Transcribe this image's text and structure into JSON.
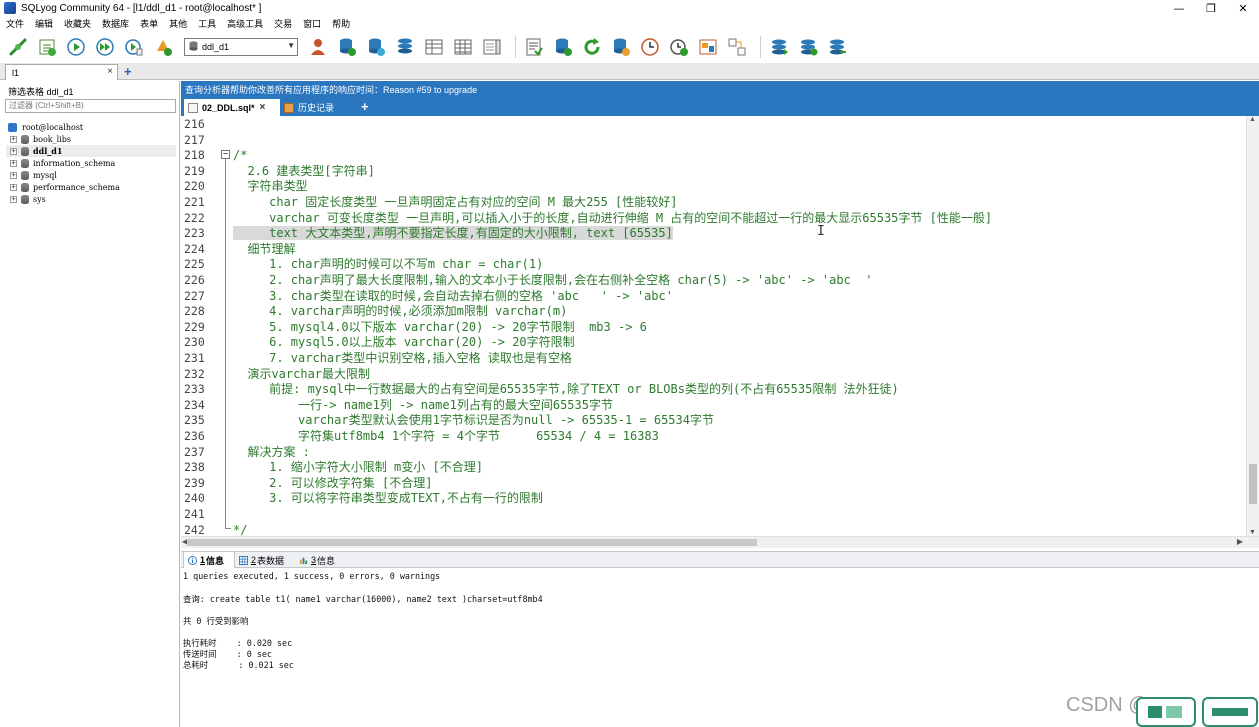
{
  "window": {
    "title": "SQLyog Community 64 - [l1/ddl_d1 - root@localhost* ]",
    "controls": [
      "—",
      "❐",
      "✕"
    ]
  },
  "menu": [
    "文件",
    "编辑",
    "收藏夹",
    "数据库",
    "表单",
    "其他",
    "工具",
    "高级工具",
    "交易",
    "窗口",
    "帮助"
  ],
  "toolbar": {
    "db_selector_value": "ddl_d1"
  },
  "session": {
    "tab_label": "l1",
    "close": "×",
    "add": "+"
  },
  "left_panel": {
    "filter_label": "筛选表格 ddl_d1",
    "filter_placeholder": "过滤器 (Ctrl+Shift+B)",
    "root": "root@localhost",
    "databases": [
      {
        "name": "book_libs",
        "selected": false
      },
      {
        "name": "ddl_d1",
        "selected": true
      },
      {
        "name": "information_schema",
        "selected": false
      },
      {
        "name": "mysql",
        "selected": false
      },
      {
        "name": "performance_schema",
        "selected": false
      },
      {
        "name": "sys",
        "selected": false
      }
    ]
  },
  "notice": "查询分析器帮助你改善所有应用程序的响应时间：Reason #59 to upgrade",
  "editor_tabs": {
    "active": "02_DDL.sql*",
    "active_close": "×",
    "history": "历史记录",
    "add": "+"
  },
  "editor": {
    "line_numbers": [
      "216",
      "217",
      "218",
      "219",
      "220",
      "221",
      "222",
      "223",
      "224",
      "225",
      "226",
      "227",
      "228",
      "229",
      "230",
      "231",
      "232",
      "233",
      "234",
      "235",
      "236",
      "237",
      "238",
      "239",
      "240",
      "241",
      "242"
    ],
    "fold_marker": "−",
    "lines": [
      "",
      "",
      "/*",
      "  2.6 建表类型[字符串]",
      "  字符串类型",
      "     char 固定长度类型 一旦声明固定占有对应的空间 M 最大255 [性能较好]",
      "     varchar 可变长度类型 一旦声明,可以插入小于的长度,自动进行伸缩 M 占有的空间不能超过一行的最大显示65535字节 [性能一般]",
      "     text 大文本类型,声明不要指定长度,有固定的大小限制, text [65535]",
      "  细节理解",
      "     1. char声明的时候可以不写m char = char(1)",
      "     2. char声明了最大长度限制,输入的文本小于长度限制,会在右侧补全空格 char(5) -> 'abc' -> 'abc  '",
      "     3. char类型在读取的时候,会自动去掉右侧的空格 'abc   ' -> 'abc'",
      "     4. varchar声明的时候,必须添加m限制 varchar(m)",
      "     5. mysql4.0以下版本 varchar(20) -> 20字节限制  mb3 -> 6",
      "     6. mysql5.0以上版本 varchar(20) -> 20字符限制",
      "     7. varchar类型中识别空格,插入空格 读取也是有空格",
      "  演示varchar最大限制",
      "     前提: mysql中一行数据最大的占有空间是65535字节,除了TEXT or BLOBs类型的列(不占有65535限制 法外狂徒)",
      "         一行-> name1列 -> name1列占有的最大空间65535字节",
      "         varchar类型默认会使用1字节标识是否为null -> 65535-1 = 65534字节",
      "         字符集utf8mb4 1个字符 = 4个字节     65534 / 4 = 16383",
      "  解决方案 :",
      "     1. 缩小字符大小限制 m变小 [不合理]",
      "     2. 可以修改字符集 [不合理]",
      "     3. 可以将字符串类型变成TEXT,不占有一行的限制",
      "",
      "*/"
    ],
    "selected_line_index": 7,
    "cursor_glyph": "I"
  },
  "result_tabs": [
    {
      "num": "1",
      "label": "信息",
      "active": true
    },
    {
      "num": "2",
      "label": "表数据",
      "active": false
    },
    {
      "num": "3",
      "label": "信息",
      "active": false
    }
  ],
  "result": {
    "summary": "1 queries executed, 1 success, 0 errors, 0 warnings",
    "query": "查询: create table t1( name1 varchar(16000), name2 text )charset=utf8mb4",
    "affected": "共 0 行受到影响",
    "exec_time": "执行耗时    : 0.020 sec",
    "transfer_time": "传送时间    : 0 sec",
    "total_time": "总耗时      : 0.021 sec"
  },
  "watermark": "CSDN @",
  "colors": {
    "accent_blue": "#2a76bf",
    "code_green": "#2e7a2e",
    "selection_gray": "#d9d9d9"
  }
}
